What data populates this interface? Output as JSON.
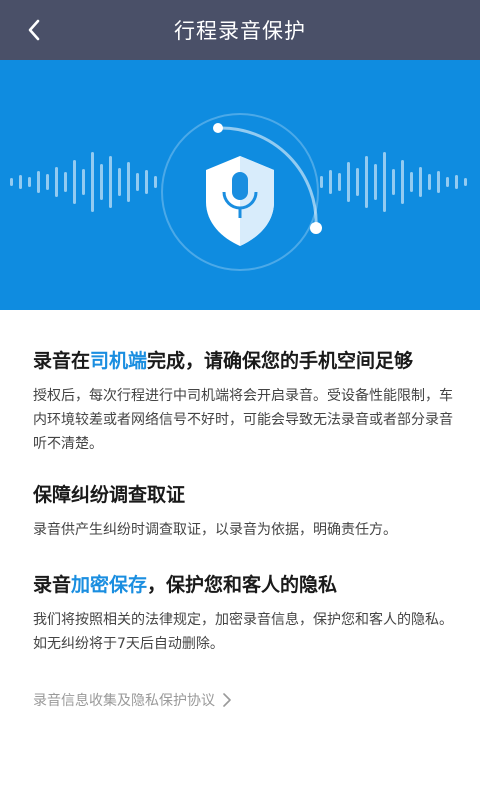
{
  "header": {
    "title": "行程录音保护",
    "back_icon": "chevron-left-icon"
  },
  "hero": {
    "icon": "shield-microphone-icon",
    "colors": {
      "background": "#0f8ce0",
      "shield": "#ffffff",
      "shield_shade": "#d8ecfb",
      "mic": "#1a8ee0"
    }
  },
  "sections": [
    {
      "title_parts": [
        "录音在",
        "司机端",
        "完成，请确保您的手机空间足够"
      ],
      "body": "授权后，每次行程进行中司机端将会开启录音。受设备性能限制，车内环境较差或者网络信号不好时，可能会导致无法录音或者部分录音听不清楚。"
    },
    {
      "title": "保障纠纷调查取证",
      "body": "录音供产生纠纷时调查取证，以录音为依据，明确责任方。"
    },
    {
      "title_parts": [
        "录音",
        "加密保存",
        "，保护您和客人的隐私"
      ],
      "body": "我们将按照相关的法律规定，加密录音信息，保护您和客人的隐私。如无纠纷将于7天后自动删除。"
    }
  ],
  "agreement": {
    "label": "录音信息收集及隐私保护协议",
    "icon": "chevron-right-icon"
  }
}
